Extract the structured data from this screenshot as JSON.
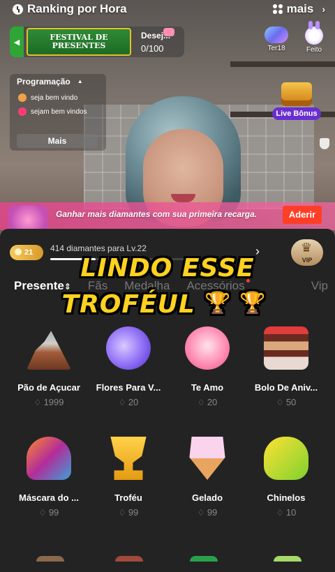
{
  "header": {
    "ranking_label": "Ranking por Hora",
    "more_label": "mais"
  },
  "festival": {
    "line1": "FESTIVAL DE",
    "line2": "PRESENTES",
    "wish_label": "Desej...",
    "wish_progress": "0/100"
  },
  "badges": {
    "ter": "Ter18",
    "done": "Feito"
  },
  "programacao": {
    "title": "Programação",
    "items": [
      "seja bem vindo",
      "sejam bem vindos"
    ],
    "more_button": "Mais"
  },
  "live_bonus": "Live Bônus",
  "recharge": {
    "text": "Ganhar mais diamantes com sua primeira recarga.",
    "button": "Aderir"
  },
  "level": {
    "level_number": "21",
    "progress_text": "414 diamantes para Lv.22",
    "progress_fraction": 0.25,
    "vip_badge": "VIP"
  },
  "tabs": [
    {
      "label": "Presente",
      "active": true
    },
    {
      "label": "Fãs"
    },
    {
      "label": "Medalha"
    },
    {
      "label": "Acessórios"
    },
    {
      "label": "Vip"
    }
  ],
  "caption": {
    "line1": "LINDO ESSE",
    "line2": "TROFÉUL",
    "emoji": "🏆 🏆"
  },
  "gifts": [
    {
      "name": "Pão de Açucar",
      "price": "1999"
    },
    {
      "name": "Flores Para V...",
      "price": "20"
    },
    {
      "name": "Te Amo",
      "price": "20"
    },
    {
      "name": "Bolo De Aniv...",
      "price": "50"
    },
    {
      "name": "Máscara do ...",
      "price": "99"
    },
    {
      "name": "Troféu",
      "price": "99"
    },
    {
      "name": "Gelado",
      "price": "99"
    },
    {
      "name": "Chinelos",
      "price": "10"
    }
  ],
  "colors": {
    "accent_pink": "#e2468c",
    "aderir_red": "#ff3e26",
    "caption_yellow": "#ffd21f",
    "live_bonus_purple": "#6a2ed0"
  }
}
